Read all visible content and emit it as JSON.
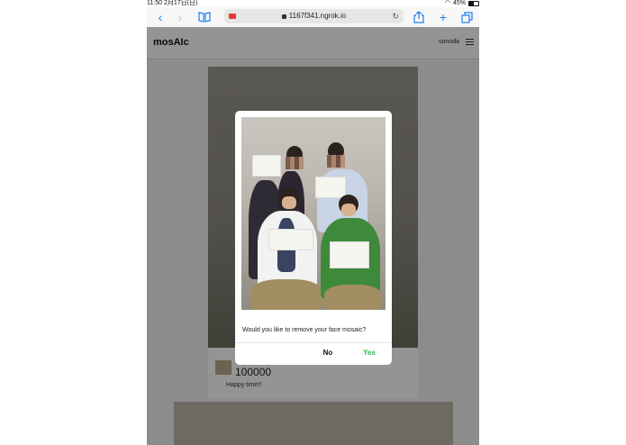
{
  "status_bar": {
    "time": "11:50",
    "date": "2月17日(日)",
    "battery": "45%"
  },
  "browser": {
    "url": "1167f341.ngrok.io"
  },
  "app": {
    "brand": "mosAIc",
    "username": "sonoda"
  },
  "post": {
    "likes": "100000",
    "caption": "Happy time!!"
  },
  "dialog": {
    "message": "Would you like to remove your face mosaic?",
    "no_label": "No",
    "yes_label": "Yes"
  },
  "colors": {
    "accent": "#1a7cf2",
    "yes": "#2ebd4e",
    "recording": "#e83a30"
  }
}
